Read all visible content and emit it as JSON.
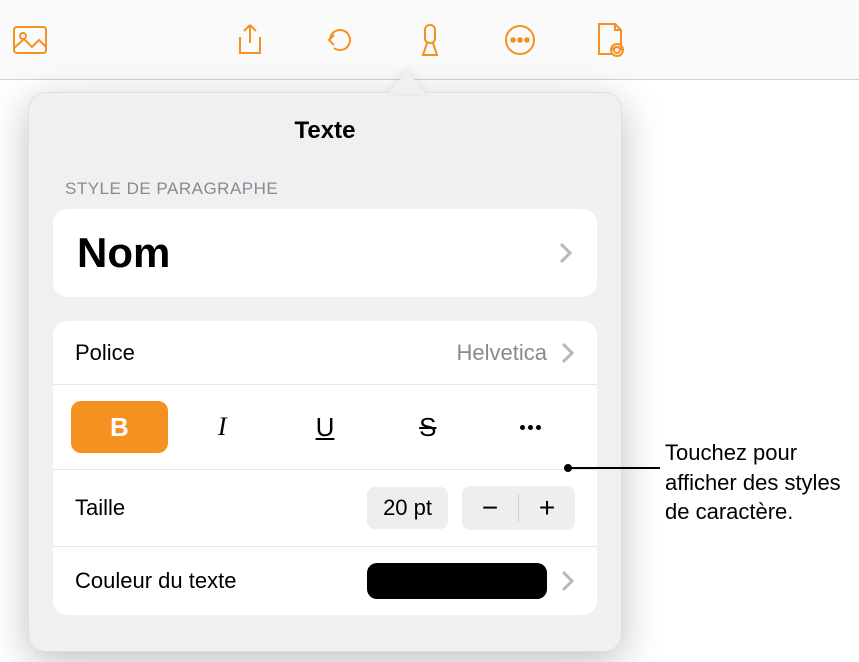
{
  "toolbar": {
    "icons": [
      "image",
      "share",
      "undo",
      "format-brush",
      "more",
      "document-view"
    ]
  },
  "popover": {
    "title": "Texte",
    "paragraph_style": {
      "label": "STYLE DE PARAGRAPHE",
      "value": "Nom"
    },
    "font": {
      "label": "Police",
      "value": "Helvetica"
    },
    "style_buttons": {
      "bold": "B",
      "italic": "I",
      "underline": "U",
      "strike": "S",
      "bold_active": true
    },
    "size": {
      "label": "Taille",
      "value": "20 pt",
      "minus": "−",
      "plus": "+"
    },
    "text_color": {
      "label": "Couleur du texte",
      "value": "#000000"
    }
  },
  "callout": {
    "text": "Touchez pour afficher des styles de caractère."
  }
}
